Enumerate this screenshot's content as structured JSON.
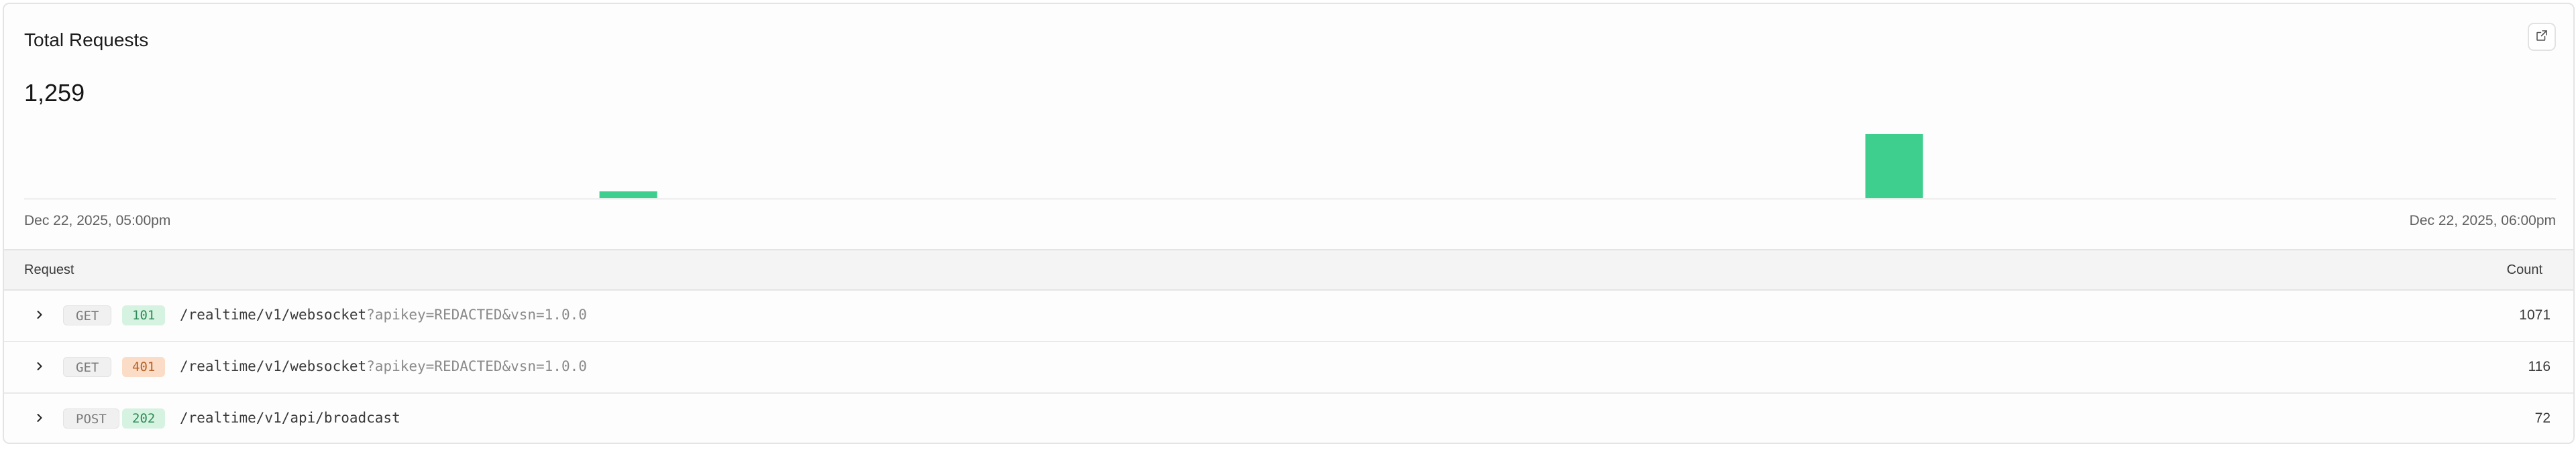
{
  "card": {
    "title": "Total Requests",
    "total": "1,259",
    "external_link_icon": "external-link-icon"
  },
  "chart_data": {
    "type": "bar",
    "bins": 44,
    "x_start_label": "Dec 22, 2025, 05:00pm",
    "x_end_label": "Dec 22, 2025, 06:00pm",
    "bars": [
      {
        "bin": 10,
        "value": 116
      },
      {
        "bin": 32,
        "value": 1071
      }
    ],
    "ylim": [
      0,
      1071
    ],
    "bar_color": "#3ecf8e",
    "grid": false
  },
  "table": {
    "headers": {
      "request": "Request",
      "count": "Count"
    },
    "rows": [
      {
        "method": "GET",
        "status": "101",
        "status_kind": "success",
        "path": "/realtime/v1/websocket",
        "query": "?apikey=REDACTED&vsn=1.0.0",
        "count": "1071"
      },
      {
        "method": "GET",
        "status": "401",
        "status_kind": "error",
        "path": "/realtime/v1/websocket",
        "query": "?apikey=REDACTED&vsn=1.0.0",
        "count": "116"
      },
      {
        "method": "POST",
        "status": "202",
        "status_kind": "success",
        "path": "/realtime/v1/api/broadcast",
        "query": "",
        "count": "72"
      }
    ]
  },
  "colors": {
    "success_bg": "#d6f3e2",
    "success_fg": "#2e8a57",
    "error_bg": "#fbdcc6",
    "error_fg": "#b8632b"
  }
}
